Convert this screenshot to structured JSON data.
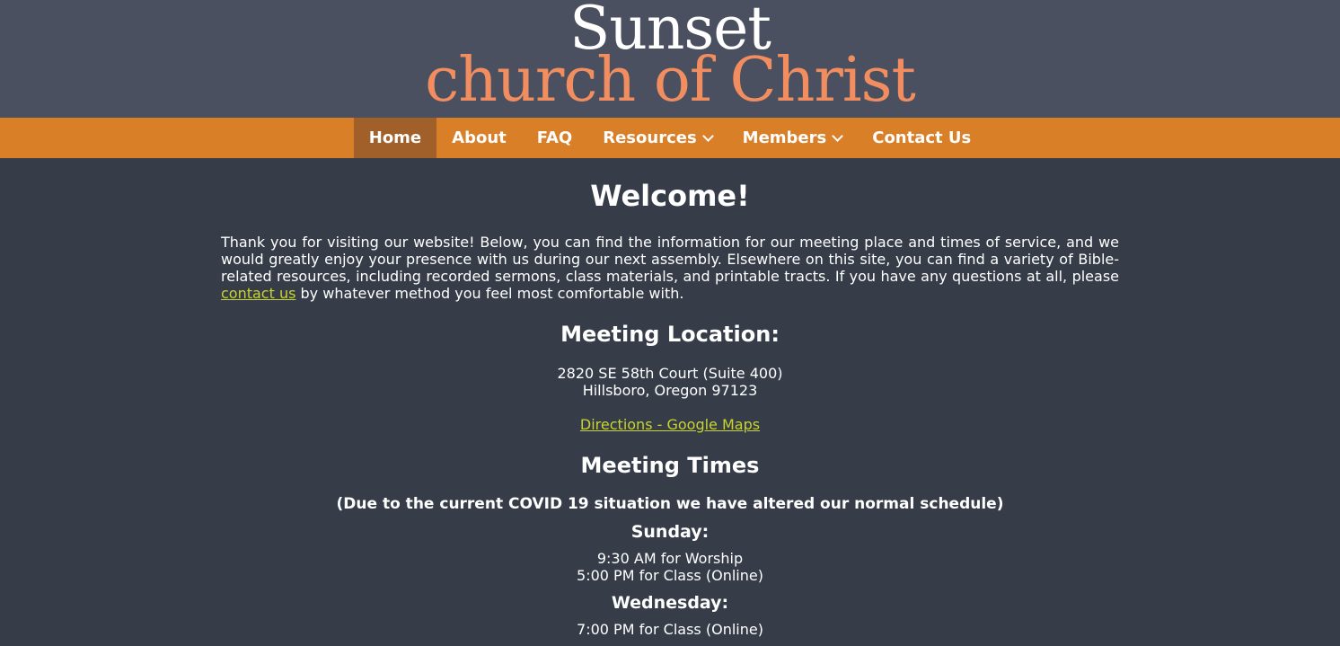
{
  "site": {
    "logo_line1": "Sunset",
    "logo_line2": "church of Christ"
  },
  "nav": {
    "items": [
      {
        "label": "Home",
        "active": true
      },
      {
        "label": "About"
      },
      {
        "label": "FAQ"
      },
      {
        "label": "Resources",
        "dropdown": true
      },
      {
        "label": "Members",
        "dropdown": true
      },
      {
        "label": "Contact Us"
      }
    ]
  },
  "main": {
    "title": "Welcome!",
    "intro_before_link": "Thank you for visiting our website! Below, you can find the information for our meeting place and times of service, and we would greatly enjoy your presence with us during our next assembly. Elsewhere on this site, you can find a variety of Bible-related resources, including recorded sermons, class materials, and printable tracts. If you have any questions at all, please ",
    "intro_link": "contact us",
    "intro_after_link": " by whatever method you feel most comfortable with.",
    "location_heading": "Meeting Location:",
    "address_line1": "2820 SE 58th Court (Suite 400)",
    "address_line2": "Hillsboro, Oregon 97123",
    "directions_link": "Directions - Google Maps",
    "times_heading": "Meeting Times",
    "covid_notice": "(Due to the current COVID 19 situation we have altered our normal schedule)",
    "sunday_label": "Sunday:",
    "sunday_times": [
      "9:30 AM for Worship",
      "5:00 PM for Class (Online)"
    ],
    "wednesday_label": "Wednesday:",
    "wednesday_times": [
      "7:00 PM for Class (Online)"
    ]
  },
  "colors": {
    "header_bg": "#4a5060",
    "nav_bg": "#d97f28",
    "nav_active_bg": "#a1602a",
    "body_bg": "#363c48",
    "logo_accent": "#f28d60",
    "link": "#c8d430"
  }
}
